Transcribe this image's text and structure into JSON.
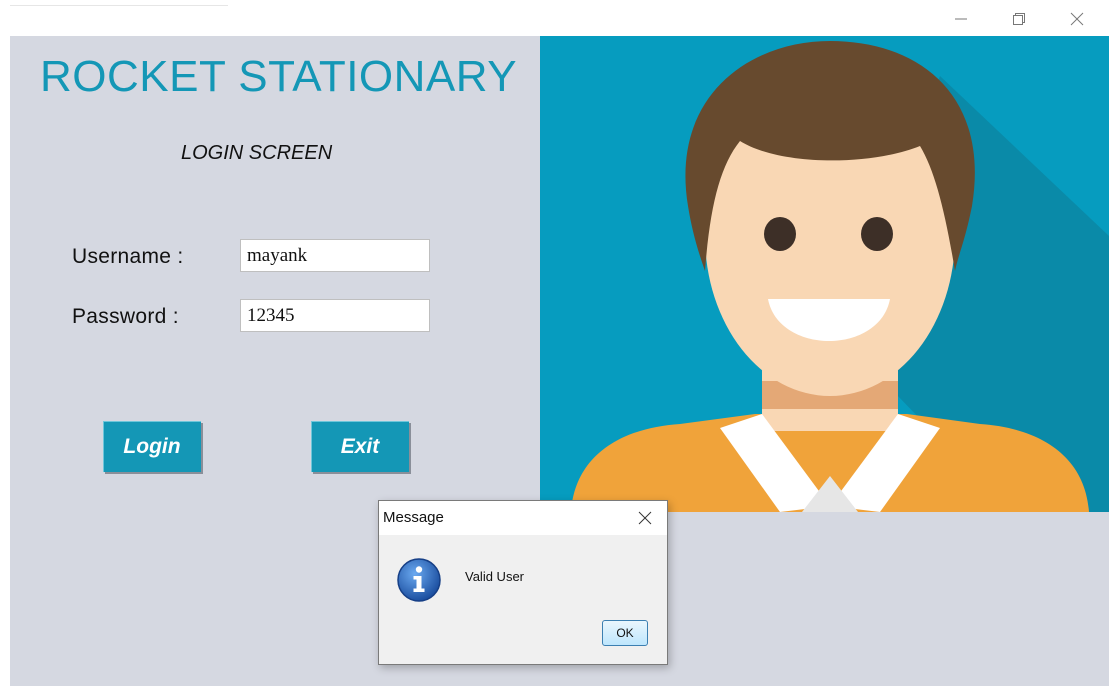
{
  "window": {
    "controls": {
      "minimize_icon": "minimize-icon",
      "maximize_icon": "restore-icon",
      "close_icon": "close-icon"
    }
  },
  "app": {
    "brand": "ROCKET STATIONARY",
    "subtitle": "LOGIN SCREEN",
    "username_label": "Username :",
    "password_label": "Password :",
    "username_value": "mayank",
    "password_value": "12345",
    "login_button": "Login",
    "exit_button": "Exit"
  },
  "dialog": {
    "title": "Message",
    "message": "Valid User",
    "ok_label": "OK",
    "icon": "info-icon"
  },
  "colors": {
    "accent": "#1497b6",
    "panel_background": "#d5d8e1",
    "avatar_background": "#069cbf"
  }
}
